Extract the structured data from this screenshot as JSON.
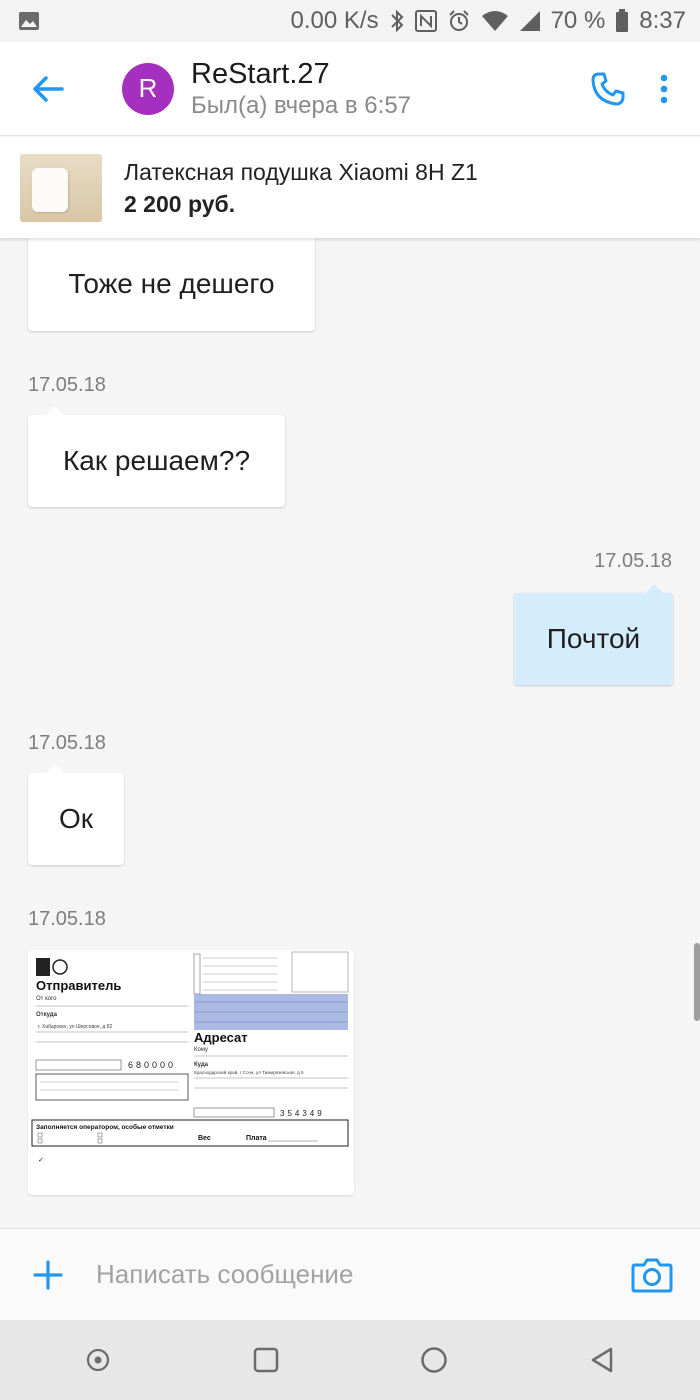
{
  "status_bar": {
    "net_speed": "0.00 K/s",
    "battery": "70 %",
    "time": "8:37",
    "icons": [
      "image-icon",
      "bluetooth-icon",
      "nfc-icon",
      "alarm-icon",
      "wifi-icon",
      "signal-icon",
      "battery-icon"
    ]
  },
  "header": {
    "avatar_letter": "R",
    "avatar_color": "#a52fbf",
    "name": "ReStart.27",
    "status": "Был(а) вчера в 6:57",
    "accent": "#2196f3"
  },
  "product": {
    "title": "Латексная подушка Xiaomi 8H Z1",
    "price": "2 200 руб."
  },
  "messages": [
    {
      "direction": "in",
      "text": "Тоже не дешего",
      "date": ""
    },
    {
      "direction": "in",
      "text": "Как решаем??",
      "date": "17.05.18"
    },
    {
      "direction": "out",
      "text": "Почтой",
      "date": "17.05.18"
    },
    {
      "direction": "in",
      "text": "Ок",
      "date": "17.05.18"
    },
    {
      "direction": "in",
      "type": "image",
      "date": "17.05.18",
      "image_text": {
        "sender_heading": "Отправитель",
        "from_label": "От кого",
        "from_where_label": "Откуда",
        "sender_address": "г. Хабаровск, ул Шерсовое, д 82",
        "sender_index": "680000",
        "recipient_heading": "Адресат",
        "to_label": "Кому",
        "to_where_label": "Куда",
        "recipient_address": "Краснодарский край, г Сочи, ул Тимирязевская, д 5",
        "recipient_index": "354349",
        "operator_note": "Заполняется оператором, особые отметки",
        "weight_label": "Вес",
        "fee_label": "Плата"
      }
    }
  ],
  "input": {
    "placeholder": "Написать сообщение"
  },
  "nav": [
    "recent-apps-dot",
    "square",
    "home-circle",
    "back-triangle"
  ]
}
